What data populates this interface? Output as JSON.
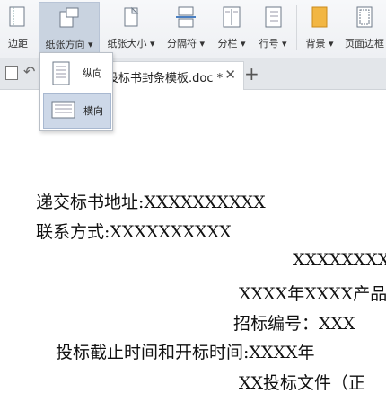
{
  "toolbar": {
    "margins_label": "边距",
    "orientation_label": "纸张方向",
    "size_label": "纸张大小",
    "breaks_label": "分隔符",
    "columns_label": "分栏",
    "line_numbers_label": "行号",
    "background_label": "背景",
    "page_border_label": "页面边框"
  },
  "tabs": {
    "doc_title": "投标书封条模板.doc *"
  },
  "orientation_menu": {
    "portrait": "纵向",
    "landscape": "横向",
    "selected": "landscape"
  },
  "document": {
    "lines": [
      "递交标书地址:XXXXXXXXXX",
      "联系方式:XXXXXXXXXX",
      "XXXXXXXX",
      "XXXX年XXXX产品",
      "招标编号：XXX",
      "投标截止时间和开标时间:XXXX年",
      "XX投标文件（正"
    ]
  }
}
